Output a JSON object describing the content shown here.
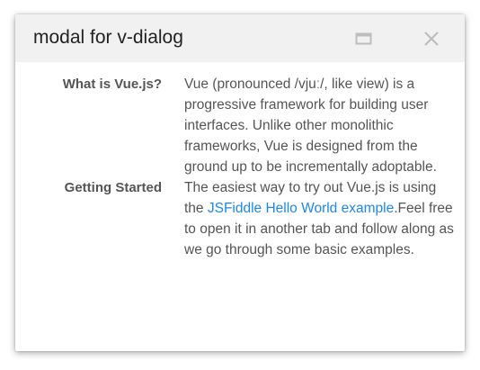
{
  "modal": {
    "title": "modal for v-dialog",
    "maximize_icon": "maximize-icon",
    "close_icon": "close-icon"
  },
  "items": [
    {
      "label": "What is Vue.js?",
      "text": "Vue (pronounced /vjuː/, like view) is a progressive framework for building user interfaces. Unlike other monolithic frameworks, Vue is designed from the ground up to be incrementally adoptable."
    },
    {
      "label": "Getting Started",
      "text_before": "The easiest way to try out Vue.js is using the ",
      "link_text": "JSFiddle Hello World example",
      "text_after": ".Feel free to open it in another tab and follow along as we go through some basic examples."
    }
  ],
  "colors": {
    "link": "#1e88e5",
    "header_bg": "#f1f1f1",
    "text": "#555555"
  }
}
